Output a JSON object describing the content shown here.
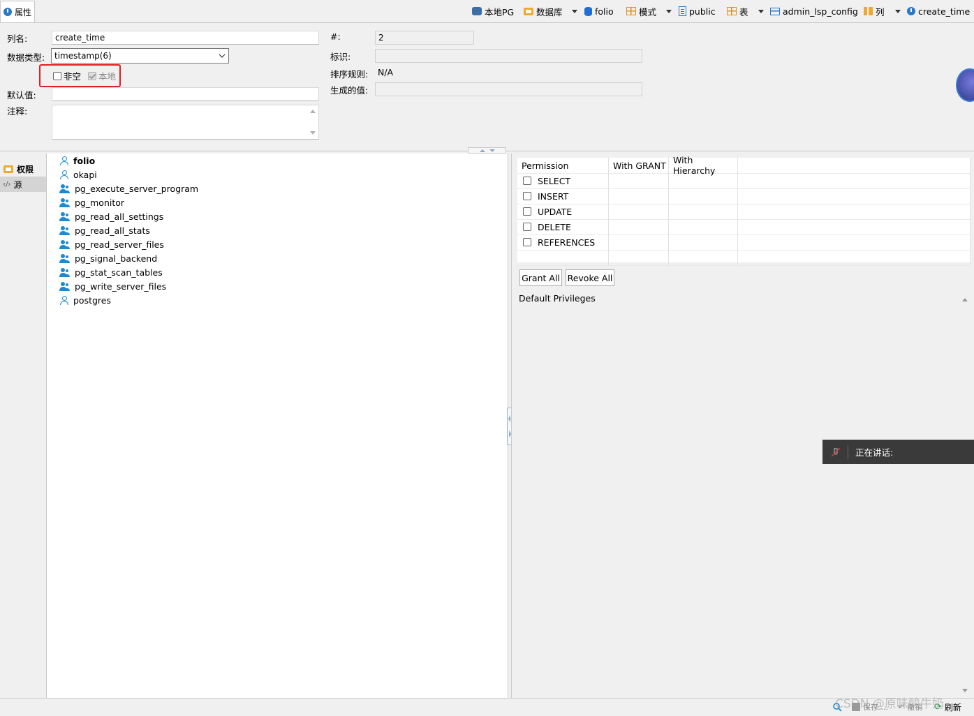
{
  "tab": {
    "label": "属性"
  },
  "breadcrumb": [
    {
      "label": "本地PG",
      "icon": "pg-server-icon"
    },
    {
      "label": "数据库",
      "icon": "database-folder-icon"
    },
    {
      "label": "folio",
      "icon": "database-icon"
    },
    {
      "label": "模式",
      "icon": "schema-folder-icon"
    },
    {
      "label": "public",
      "icon": "schema-icon"
    },
    {
      "label": "表",
      "icon": "tables-folder-icon"
    },
    {
      "label": "admin_lsp_config",
      "icon": "table-icon"
    },
    {
      "label": "列",
      "icon": "columns-folder-icon"
    },
    {
      "label": "create_time",
      "icon": "column-clock-icon"
    }
  ],
  "form": {
    "column_name_label": "列名:",
    "column_name_value": "create_time",
    "data_type_label": "数据类型:",
    "data_type_value": "timestamp(6)",
    "not_null_label": "非空",
    "local_label": "本地",
    "default_label": "默认值:",
    "default_value": "",
    "comment_label": "注释:",
    "comment_value": "",
    "position_label": "#:",
    "position_value": "2",
    "identity_label": "标识:",
    "identity_value": "",
    "collation_label": "排序规则:",
    "collation_value": "N/A",
    "generated_label": "生成的值:",
    "generated_value": ""
  },
  "side_tabs": [
    {
      "label": "权限",
      "active": true
    },
    {
      "label": "源",
      "active": false
    }
  ],
  "users": [
    {
      "name": "folio",
      "type": "user",
      "bold": true
    },
    {
      "name": "okapi",
      "type": "user"
    },
    {
      "name": "pg_execute_server_program",
      "type": "group"
    },
    {
      "name": "pg_monitor",
      "type": "group"
    },
    {
      "name": "pg_read_all_settings",
      "type": "group"
    },
    {
      "name": "pg_read_all_stats",
      "type": "group"
    },
    {
      "name": "pg_read_server_files",
      "type": "group"
    },
    {
      "name": "pg_signal_backend",
      "type": "group"
    },
    {
      "name": "pg_stat_scan_tables",
      "type": "group"
    },
    {
      "name": "pg_write_server_files",
      "type": "group"
    },
    {
      "name": "postgres",
      "type": "user"
    }
  ],
  "permissions": {
    "headers": [
      "Permission",
      "With GRANT",
      "With Hierarchy"
    ],
    "rows": [
      "SELECT",
      "INSERT",
      "UPDATE",
      "DELETE",
      "REFERENCES"
    ]
  },
  "buttons": {
    "grant_all": "Grant All",
    "revoke_all": "Revoke All"
  },
  "default_privileges_label": "Default Privileges",
  "talking_label": "正在讲话:",
  "status": {
    "save": "保存 ...",
    "revert": "撤销",
    "refresh": "刷新"
  },
  "watermark": "CSDN @原味酸牛奶",
  "colors": {
    "accent": "#1a8ad4",
    "highlight_box": "#e02020",
    "folder": "#f0a830"
  }
}
